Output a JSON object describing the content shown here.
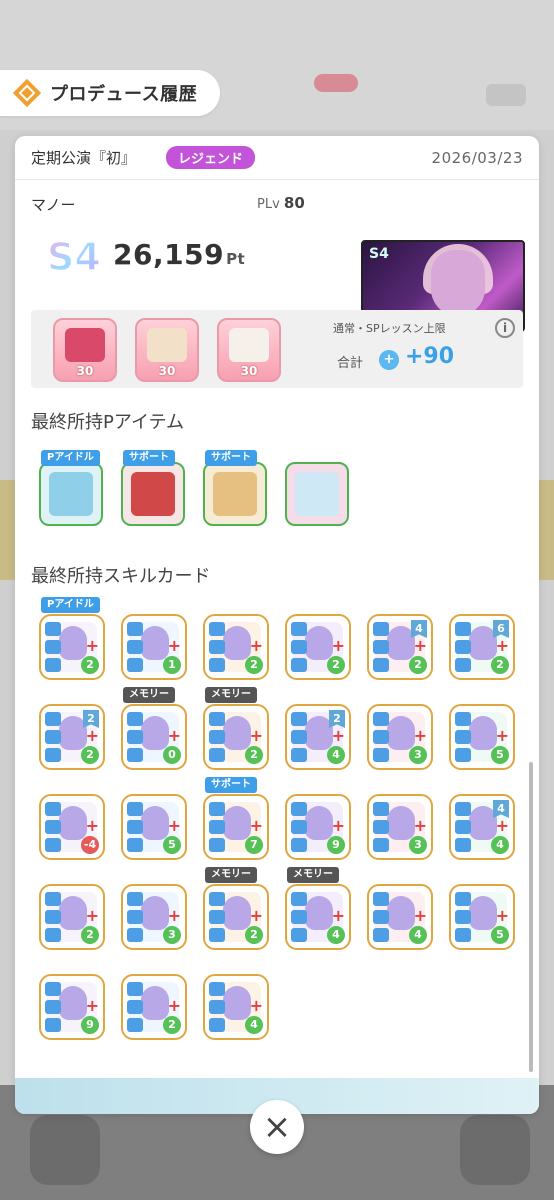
{
  "header": {
    "title": "プロデュース履歴",
    "icon": "produce-history-icon"
  },
  "record": {
    "concert_title": "定期公演『初』",
    "rank_badge": "レジェンド",
    "date": "2026/03/23",
    "idol_name": "マノー",
    "plv_label": "PLv",
    "plv_value": "80",
    "grade": "S4",
    "score": "26,159",
    "score_unit": "Pt",
    "thumb_tag": "S4"
  },
  "sp_section": {
    "caption": "通常・SPレッスン上限",
    "total_label": "合計",
    "total_value": "+90",
    "items": [
      {
        "name": "music-player",
        "cost": "30"
      },
      {
        "name": "bag-charm",
        "cost": "30"
      },
      {
        "name": "ribbon-pouch",
        "cost": "30"
      }
    ]
  },
  "p_items_section": {
    "title": "最終所持Pアイテム",
    "items": [
      {
        "name": "notebook",
        "tag": "Pアイドル"
      },
      {
        "name": "water-gun",
        "tag": "サポート"
      },
      {
        "name": "envelope",
        "tag": "サポート"
      },
      {
        "name": "figure",
        "tag": ""
      }
    ]
  },
  "skill_section": {
    "title": "最終所持スキルカード",
    "cards": [
      {
        "tag": "Pアイドル",
        "cost": "2",
        "corner": ""
      },
      {
        "tag": "",
        "cost": "1",
        "corner": ""
      },
      {
        "tag": "",
        "cost": "2",
        "corner": ""
      },
      {
        "tag": "",
        "cost": "2",
        "corner": ""
      },
      {
        "tag": "",
        "cost": "2",
        "corner": "4"
      },
      {
        "tag": "",
        "cost": "2",
        "corner": "6"
      },
      {
        "tag": "",
        "cost": "2",
        "corner": "2"
      },
      {
        "tag": "メモリー",
        "cost": "0",
        "corner": ""
      },
      {
        "tag": "メモリー",
        "cost": "2",
        "corner": ""
      },
      {
        "tag": "",
        "cost": "4",
        "corner": "2"
      },
      {
        "tag": "",
        "cost": "3",
        "corner": ""
      },
      {
        "tag": "",
        "cost": "5",
        "corner": ""
      },
      {
        "tag": "",
        "cost": "-4",
        "corner": ""
      },
      {
        "tag": "",
        "cost": "5",
        "corner": ""
      },
      {
        "tag": "サポート",
        "cost": "7",
        "corner": ""
      },
      {
        "tag": "",
        "cost": "9",
        "corner": ""
      },
      {
        "tag": "",
        "cost": "3",
        "corner": ""
      },
      {
        "tag": "",
        "cost": "4",
        "corner": "4"
      },
      {
        "tag": "",
        "cost": "2",
        "corner": ""
      },
      {
        "tag": "",
        "cost": "3",
        "corner": ""
      },
      {
        "tag": "メモリー",
        "cost": "2",
        "corner": ""
      },
      {
        "tag": "メモリー",
        "cost": "4",
        "corner": ""
      },
      {
        "tag": "",
        "cost": "4",
        "corner": ""
      },
      {
        "tag": "",
        "cost": "5",
        "corner": ""
      },
      {
        "tag": "",
        "cost": "9",
        "corner": ""
      },
      {
        "tag": "",
        "cost": "2",
        "corner": ""
      },
      {
        "tag": "",
        "cost": "4",
        "corner": ""
      }
    ]
  },
  "close_button": "×",
  "colors": {
    "rank_badge": "#c353d9",
    "plus_value": "#3aa0e8",
    "support_tag": "#3e9ee8",
    "memory_tag": "#555555",
    "card_border": "#e0a640"
  }
}
